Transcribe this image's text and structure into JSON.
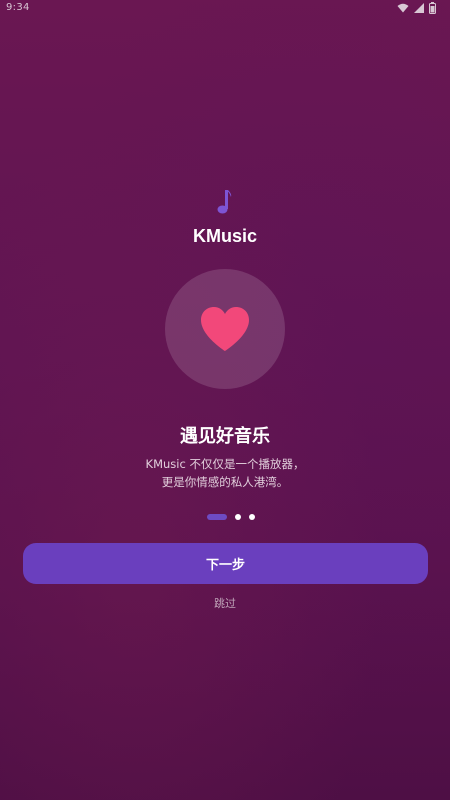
{
  "status_bar": {
    "time": "9:34",
    "icons": [
      "wifi-icon",
      "signal-icon",
      "battery-icon"
    ]
  },
  "app": {
    "logo_icon": "music-note-icon",
    "name": "KMusic"
  },
  "hero": {
    "icon": "heart-icon",
    "heart_color": "#f2487a"
  },
  "content": {
    "headline": "遇见好音乐",
    "description_line1": "KMusic 不仅仅是一个播放器，",
    "description_line2": "更是你情感的私人港湾。"
  },
  "pager": {
    "total": 3,
    "active_index": 0,
    "active_color": "#6d4bc3"
  },
  "actions": {
    "next_label": "下一步",
    "skip_label": "跳过"
  },
  "colors": {
    "accent": "#6a3fbe",
    "background": "#5f1452"
  }
}
